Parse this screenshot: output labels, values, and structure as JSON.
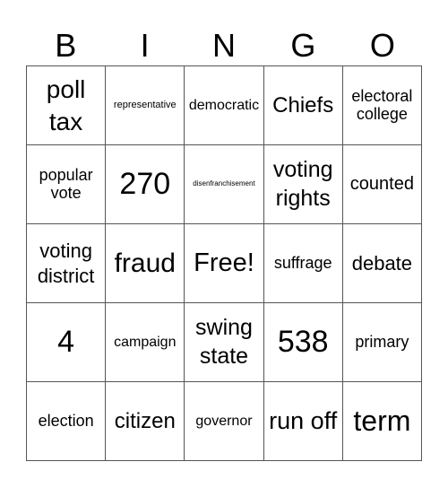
{
  "header": {
    "letters": [
      "B",
      "I",
      "N",
      "G",
      "O"
    ]
  },
  "cells": [
    [
      "poll tax",
      "representative",
      "democratic",
      "Chiefs",
      "electoral college"
    ],
    [
      "popular vote",
      "270",
      "disenfranchisement",
      "voting rights",
      "counted"
    ],
    [
      "voting district",
      "fraud",
      "Free!",
      "suffrage",
      "debate"
    ],
    [
      "4",
      "campaign",
      "swing state",
      "538",
      "primary"
    ],
    [
      "election",
      "citizen",
      "governor",
      "run off",
      "term"
    ]
  ]
}
